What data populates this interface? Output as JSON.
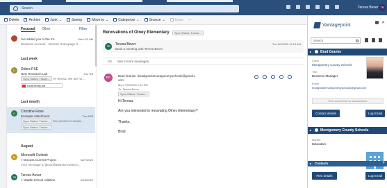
{
  "header": {
    "search_placeholder": "Search",
    "user_name": "Teresa Bever",
    "user_initials": "TB"
  },
  "toolbar": {
    "delete": "Delete",
    "archive": "Archive",
    "junk": "Junk",
    "sweep": "Sweep",
    "move_to": "Move to",
    "categorize": "Categorize",
    "snooze": "Snooze",
    "undo": "Undo"
  },
  "message_list": {
    "tab_focused": "Focused",
    "tab_other": "Other",
    "filter": "Filter",
    "first": {
      "subject": "I've added you to the Int...",
      "date": "Wed 9/2 AM",
      "preview": "Business Account - Intranet Homepage X..."
    },
    "group_last_week": "Last week",
    "debra": {
      "from": "Debra PSE",
      "subject": "New Research Lab",
      "date": "Tue 9/8",
      "chip": "Sync Status: Tracke...",
      "preview": "Hi Teresa, We are ho...",
      "attachment": "roots-firefly.pdf"
    },
    "group_last_month": "Last month",
    "christine": {
      "from": "Christine Rose",
      "subject": "Example Attachment",
      "date": "Thu 8/28",
      "chip1": "Sync Status: Tracke...",
      "chip2": "Sync Status: Tracke...",
      "preview": "No preview is availa..."
    },
    "group_august": "August",
    "outlook": {
      "from": "Microsoft Outlook",
      "subject": "> Discuss Current Project",
      "date": "8/27/2020",
      "preview": "Your message to jboxx@atlanticresearch..."
    },
    "teresa": {
      "from": "Teresa Bever",
      "subject": "> Middle School Addition",
      "date": "8/26/2020"
    }
  },
  "reading_pane": {
    "subject": "Renovations of Olney Elementary",
    "sync_chip": "Sync Status: Tracke...",
    "meeting": {
      "initials": "TB",
      "name": "Teresa Bever",
      "desc": "Book a meeting with Teresa Bever",
      "time": "Tue 8/4/2020 11:15 AM"
    },
    "see_more": "See 2 more messages",
    "email": {
      "initials": "BG",
      "from": "Brad Granke <bradgrankemontgomeryschools@gmail.c",
      "from2": "om>",
      "sent": "Mon 7/20/2020 2:04 PM",
      "to": "To: Teresa Bever",
      "chip": "Sync Status: Tracke...",
      "greeting": "Hi Teresa,",
      "line1": "Are you interested in renovating Olney Elementary?",
      "line2": "Thanks,",
      "signoff": "Brad"
    }
  },
  "vantagepoint": {
    "title": "Vantagepoint",
    "search_placeholder": "Search",
    "contact": {
      "header": "Brad Granke",
      "client_label": "Client",
      "client_value": "Montgomery County Schools",
      "title_label": "Title",
      "title_value": "Business Manager",
      "email_label": "Email",
      "email_value": "bradgrankemontgomeryschools@gmail.com",
      "no_assoc": "This record has no associations.",
      "contact_details": "Contact details",
      "log_email": "Log Email"
    },
    "firm": {
      "header": "Montgomery County Schools",
      "market_label": "Market",
      "market_value": "Education",
      "contacts_header": "Contacts",
      "firm_details": "Firm details",
      "log_email": "Log Email"
    }
  }
}
